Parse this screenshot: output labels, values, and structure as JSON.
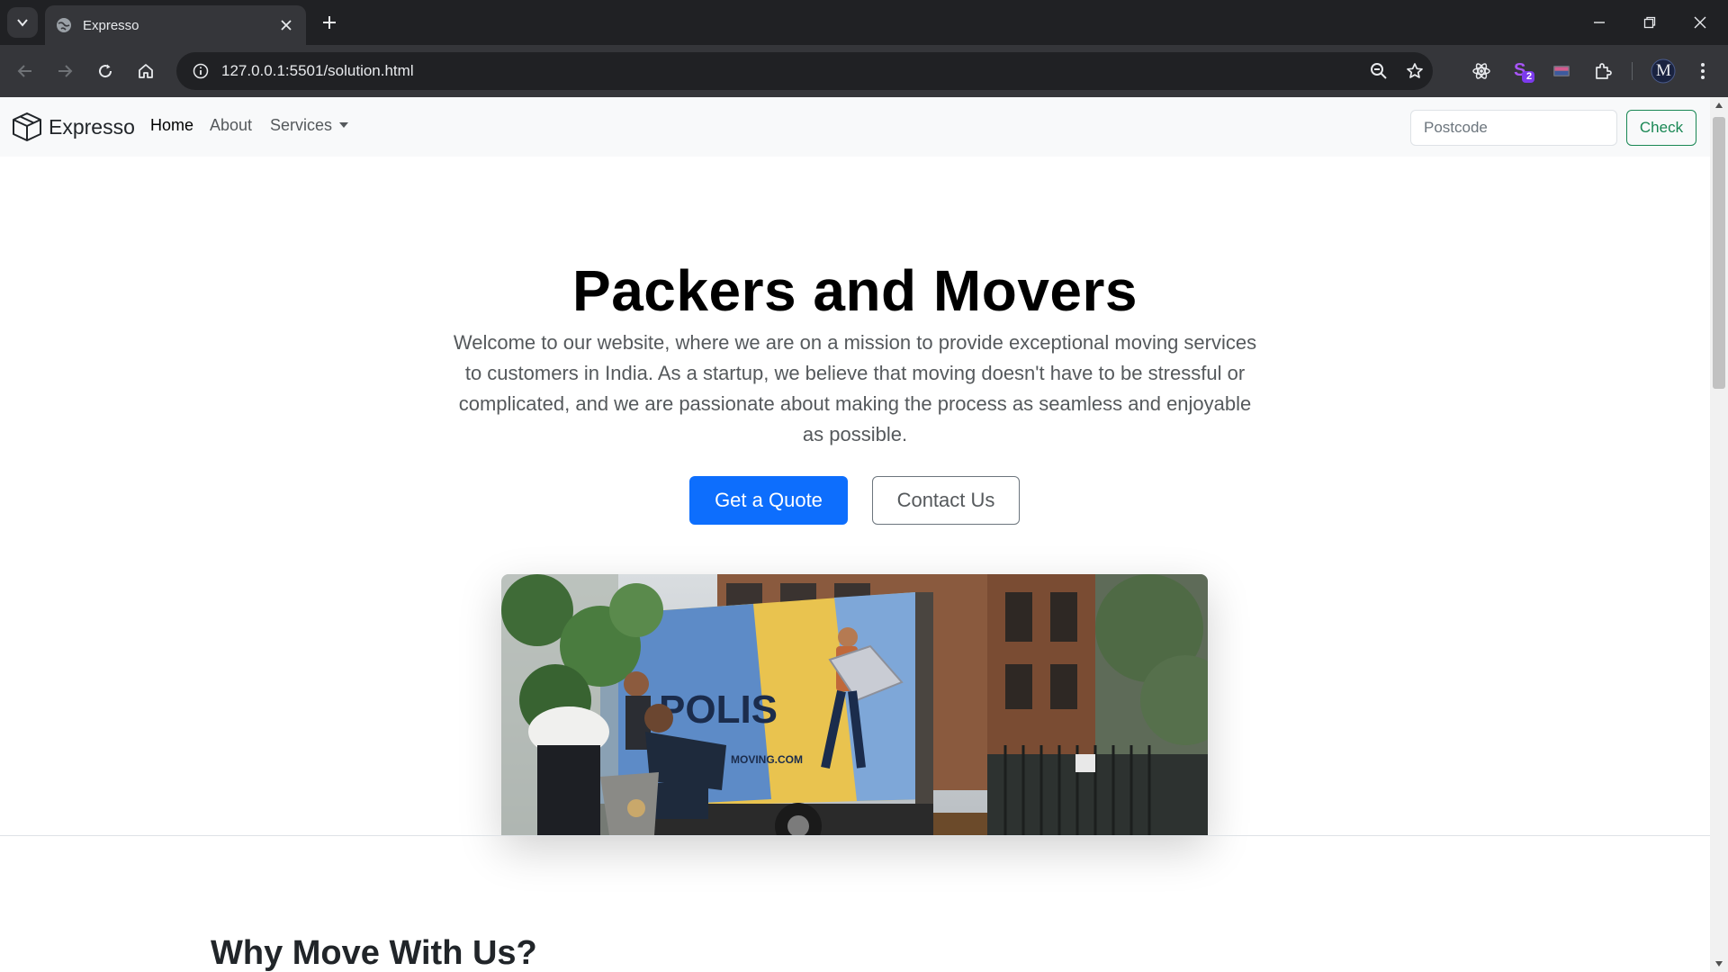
{
  "browser": {
    "tab_title": "Expresso",
    "url": "127.0.0.1:5501/solution.html",
    "extension_badge": "2",
    "profile_initial": "M"
  },
  "site": {
    "brand": "Expresso",
    "nav": {
      "home": "Home",
      "about": "About",
      "services": "Services"
    },
    "postcode_placeholder": "Postcode",
    "check_label": "Check"
  },
  "hero": {
    "title": "Packers and Movers",
    "text": "Welcome to our website, where we are on a mission to provide exceptional moving services to customers in India. As a startup, we believe that moving doesn't have to be stressful or complicated, and we are passionate about making the process as seamless and enjoyable as possible.",
    "primary_button": "Get a Quote",
    "secondary_button": "Contact Us",
    "truck_text": "POLIS",
    "truck_url": "MOVING.COM"
  },
  "section": {
    "why_title": "Why Move With Us?"
  },
  "colors": {
    "primary": "#0d6efd",
    "success": "#198754",
    "chrome_dark": "#202124",
    "chrome_mid": "#35363a",
    "nav_bg": "#f8f9fa"
  }
}
